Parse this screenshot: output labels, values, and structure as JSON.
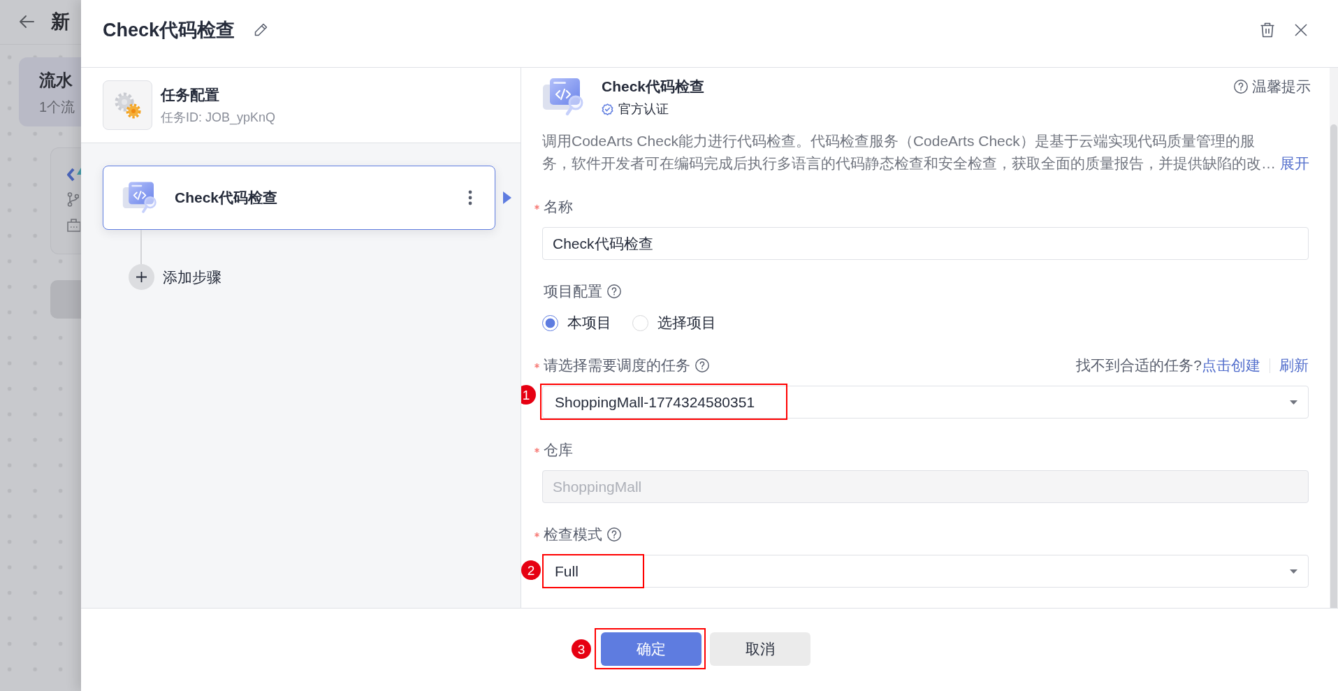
{
  "background_page": {
    "title": "新",
    "pipeline_card": {
      "title": "流水",
      "subtitle": "1个流"
    }
  },
  "drawer": {
    "title": "Check代码检查"
  },
  "task": {
    "title": "任务配置",
    "id": "任务ID: JOB_ypKnQ"
  },
  "steps": [
    {
      "name": "Check代码检查",
      "selected": true
    }
  ],
  "add_step": "添加步骤",
  "plugin": {
    "name": "Check代码检查",
    "certification": "官方认证",
    "tips": "温馨提示",
    "description": "调用CodeArts Check能力进行代码检查。代码检查服务（CodeArts Check）是基于云端实现代码质量管理的服务，软件开发者可在编码完成后执行多语言的代码静态检查和安全检查，获取全面的质量报告，并提供缺陷的改…",
    "expand": "展开"
  },
  "form": [
    {
      "kind": "input",
      "label": "名称",
      "required": true,
      "help": false,
      "disabled": false,
      "value": "Check代码检查"
    },
    {
      "kind": "radio",
      "label": "项目配置",
      "required": false,
      "help": true,
      "disabled": false,
      "options": [
        {
          "label": "本项目",
          "selected": true
        },
        {
          "label": "选择项目",
          "selected": false
        }
      ]
    },
    {
      "kind": "select",
      "label": "请选择需要调度的任务",
      "required": true,
      "help": true,
      "disabled": false,
      "hint": "找不到合适的任务?",
      "links": [
        "点击创建",
        "刷新"
      ],
      "value": "ShoppingMall-1774324580351",
      "annotation": "1"
    },
    {
      "kind": "input",
      "label": "仓库",
      "required": true,
      "help": false,
      "disabled": true,
      "value": "ShoppingMall"
    },
    {
      "kind": "select",
      "label": "检查模式",
      "required": true,
      "help": true,
      "disabled": false,
      "value": "Full",
      "annotation": "2"
    }
  ],
  "footer": {
    "buttons": [
      {
        "label": "确定",
        "kind": "primary",
        "annotation": "3"
      },
      {
        "label": "取消",
        "kind": "secondary"
      }
    ]
  }
}
